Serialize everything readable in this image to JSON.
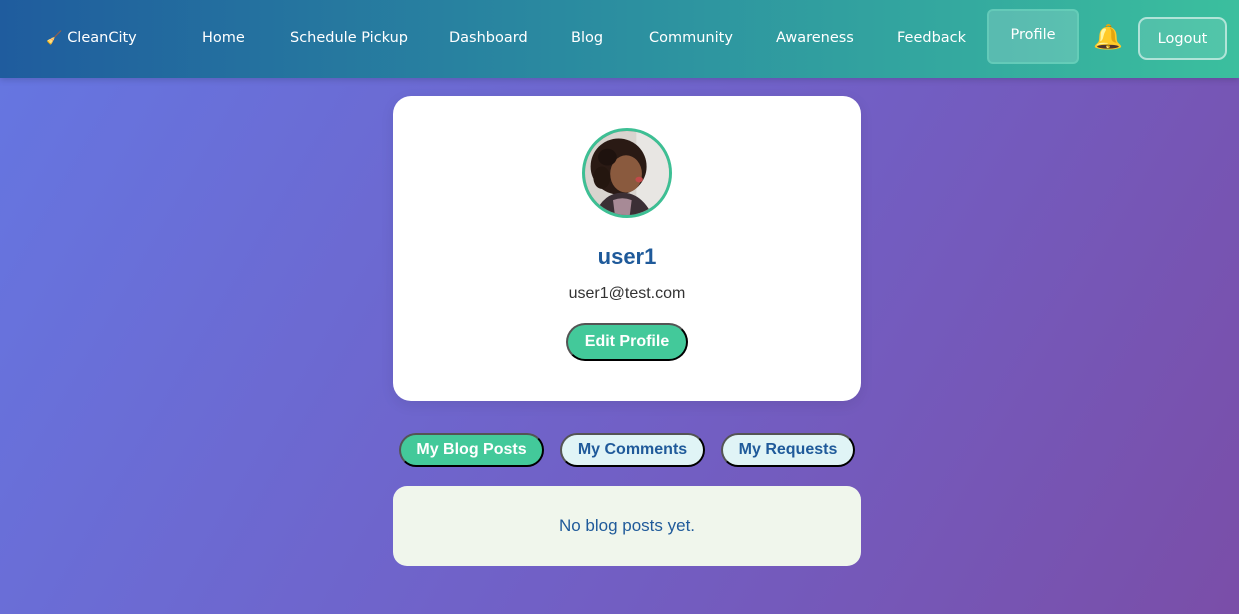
{
  "app": {
    "brand": "CleanCity",
    "brand_icon": "broom-icon"
  },
  "nav": {
    "links": [
      "Home",
      "Schedule Pickup",
      "Dashboard",
      "Blog",
      "Community",
      "Awareness",
      "Feedback"
    ],
    "active": "Profile",
    "bell_icon": "bell-icon",
    "logout": "Logout"
  },
  "profile": {
    "username": "user1",
    "email": "user1@test.com",
    "edit_button": "Edit Profile"
  },
  "tabs": [
    {
      "label": "My Blog Posts",
      "active": true
    },
    {
      "label": "My Comments",
      "active": false
    },
    {
      "label": "My Requests",
      "active": false
    }
  ],
  "content": {
    "empty_message": "No blog posts yet."
  },
  "colors": {
    "accent": "#43c99a",
    "primary_text": "#1f5a9a"
  }
}
